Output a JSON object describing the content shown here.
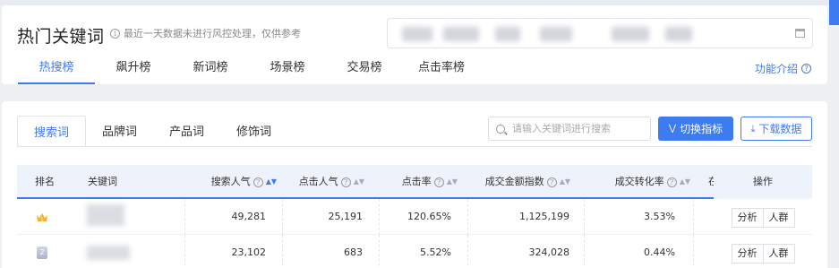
{
  "header": {
    "title": "热门关键词",
    "notice": "最近一天数据未进行风控处理，仅供参考",
    "help_link": "功能介绍"
  },
  "main_tabs": [
    "热搜榜",
    "飙升榜",
    "新词榜",
    "场景榜",
    "交易榜",
    "点击率榜"
  ],
  "sub_tabs": [
    "搜索词",
    "品牌词",
    "产品词",
    "修饰词"
  ],
  "search": {
    "placeholder": "请输入关键词进行搜索"
  },
  "buttons": {
    "switch_metric": "切换指标",
    "download": "下载数据"
  },
  "table": {
    "headers": {
      "rank": "排名",
      "keyword": "关键词",
      "search_popularity": "搜索人气",
      "click_popularity": "点击人气",
      "ctr": "点击率",
      "gmv_index": "成交金额指数",
      "conversion": "成交转化率",
      "partial": "在",
      "ops": "操作"
    },
    "rows": [
      {
        "rank": "1",
        "search_popularity": "49,281",
        "click_popularity": "25,191",
        "ctr": "120.65%",
        "gmv_index": "1,125,199",
        "conversion": "3.53%"
      },
      {
        "rank": "2",
        "search_popularity": "23,102",
        "click_popularity": "683",
        "ctr": "5.52%",
        "gmv_index": "324,028",
        "conversion": "0.44%"
      }
    ],
    "op_labels": {
      "analyze": "分析",
      "crowd": "人群"
    }
  },
  "colors": {
    "accent": "#3d7bf0",
    "header_bg": "#eef2fa",
    "page_bg": "#eef0f4"
  }
}
